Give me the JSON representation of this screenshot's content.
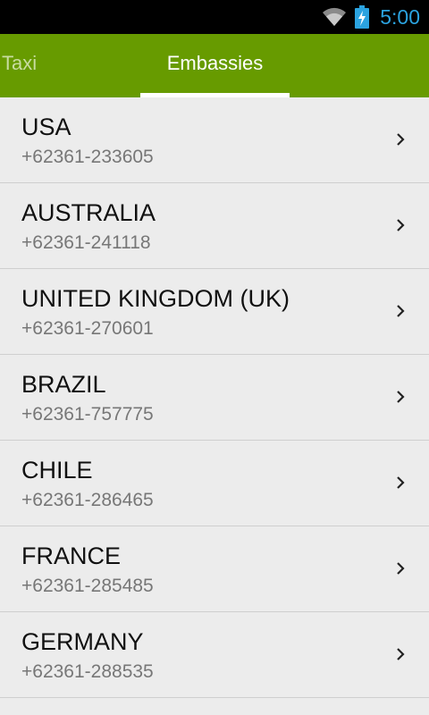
{
  "status_bar": {
    "time": "5:00",
    "wifi_icon": "wifi-icon",
    "battery_icon": "battery-charging-icon",
    "accent_color": "#2ba3e0"
  },
  "tabs": [
    {
      "label": "Taxi",
      "selected": false
    },
    {
      "label": "Embassies",
      "selected": true
    }
  ],
  "colors": {
    "tab_bar": "#679b00",
    "list_background": "#ececec"
  },
  "embassies": [
    {
      "name": "USA",
      "phone": "+62361-233605"
    },
    {
      "name": "AUSTRALIA",
      "phone": "+62361-241118"
    },
    {
      "name": "UNITED KINGDOM (UK)",
      "phone": "+62361-270601"
    },
    {
      "name": "BRAZIL",
      "phone": "+62361-757775"
    },
    {
      "name": "CHILE",
      "phone": "+62361-286465"
    },
    {
      "name": "FRANCE",
      "phone": "+62361-285485"
    },
    {
      "name": "GERMANY",
      "phone": "+62361-288535"
    }
  ],
  "item_icon": "chevron-right-icon"
}
